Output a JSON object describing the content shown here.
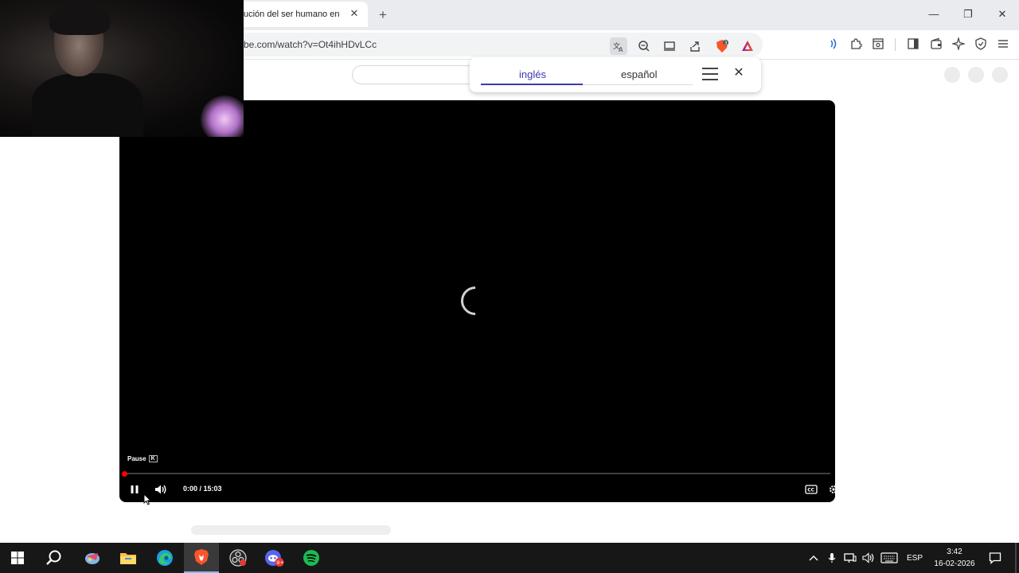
{
  "browser": {
    "tab": {
      "title": "ución del ser humano en",
      "close_glyph": "✕"
    },
    "new_tab_glyph": "+",
    "window_controls": {
      "minimize": "—",
      "maximize": "❐",
      "close": "✕"
    },
    "address_bar": {
      "url": "be.com/watch?v=Ot4ihHDvLCc"
    },
    "toolbar_icons": [
      "translate-icon",
      "zoom-out-icon",
      "cast-icon",
      "share-icon",
      "brave-shields-icon",
      "brave-rewards-icon",
      "wallet-icon",
      "leo-ai-icon",
      "vpn-icon"
    ],
    "extension_icons": [
      "speech-icon",
      "extensions-puzzle-icon",
      "reader-mode-icon",
      "sidebar-icon",
      "wallet-icon",
      "leo-ai-icon",
      "vpn-icon",
      "menu-icon"
    ],
    "shield_badge": "3"
  },
  "translate_popup": {
    "source_lang": "inglés",
    "target_lang": "español",
    "close_glyph": "✕"
  },
  "player": {
    "tooltip_label": "Pause",
    "tooltip_key": "K",
    "time_display": "0:00 / 15:03",
    "progress": 0.0,
    "state": "loading"
  },
  "taskbar": {
    "apps": [
      "windows-start-icon",
      "search-icon",
      "krita-icon",
      "file-explorer-icon",
      "edge-icon",
      "brave-icon",
      "obs-icon",
      "discord-icon",
      "spotify-icon"
    ],
    "active_app": "brave-icon",
    "discord_badge": "9+",
    "language": "ESP",
    "time": "3:42",
    "date": "16-02-2026"
  },
  "colors": {
    "accent": "#3b3bb3",
    "progress_red": "#ff0000",
    "taskbar_bg": "#171717",
    "spotify_green": "#1db954",
    "brave_orange": "#fb542b"
  }
}
